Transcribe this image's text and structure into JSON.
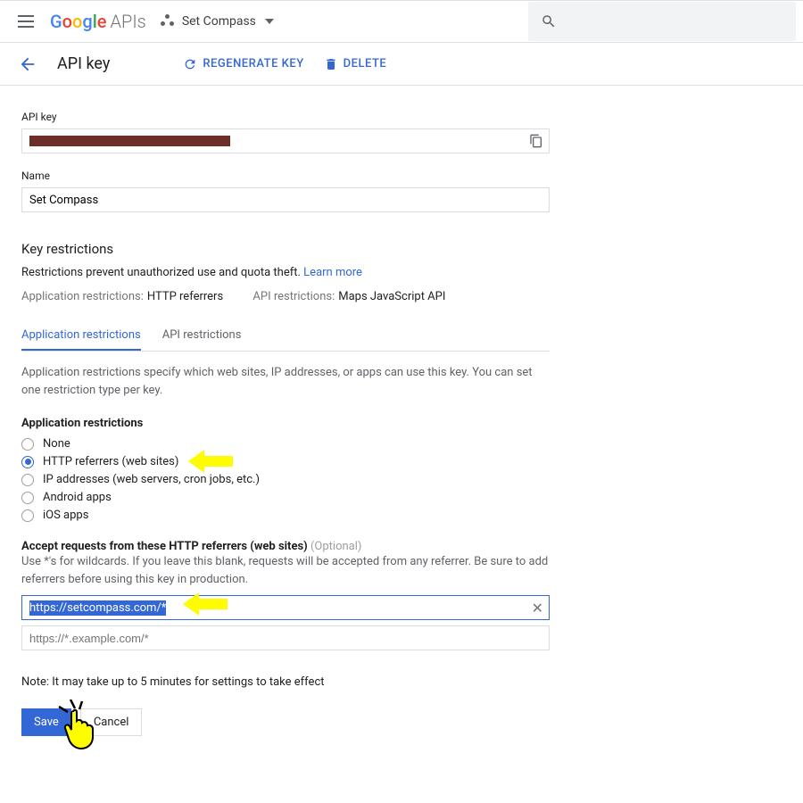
{
  "topbar": {
    "logo_apis": "APIs",
    "project_name": "Set Compass"
  },
  "subbar": {
    "title": "API key",
    "regenerate": "REGENERATE KEY",
    "delete": "DELETE"
  },
  "fields": {
    "apikey_label": "API key",
    "name_label": "Name",
    "name_value": "Set Compass"
  },
  "restrictions": {
    "title": "Key restrictions",
    "desc_text": "Restrictions prevent unauthorized use and quota theft. ",
    "learn_more": "Learn more",
    "app_label": "Application restrictions:",
    "app_value": "HTTP referrers",
    "api_label": "API restrictions:",
    "api_value": "Maps JavaScript API"
  },
  "tabs": {
    "app": "Application restrictions",
    "api": "API restrictions"
  },
  "app_tab": {
    "help": "Application restrictions specify which web sites, IP addresses, or apps can use this key. You can set one restriction type per key.",
    "radio_title": "Application restrictions",
    "options": {
      "none": "None",
      "http": "HTTP referrers (web sites)",
      "ip": "IP addresses (web servers, cron jobs, etc.)",
      "android": "Android apps",
      "ios": "iOS apps"
    },
    "accept_label": "Accept requests from these HTTP referrers (web sites) ",
    "optional": "(Optional)",
    "accept_help": "Use *'s for wildcards. If you leave this blank, requests will be accepted from any referrer. Be sure to add referrers before using this key in production.",
    "referrer_value": "https://setcompass.com/*",
    "referrer_placeholder": "https://*.example.com/*",
    "note": "Note: It may take up to 5 minutes for settings to take effect"
  },
  "buttons": {
    "save": "Save",
    "cancel": "Cancel"
  }
}
